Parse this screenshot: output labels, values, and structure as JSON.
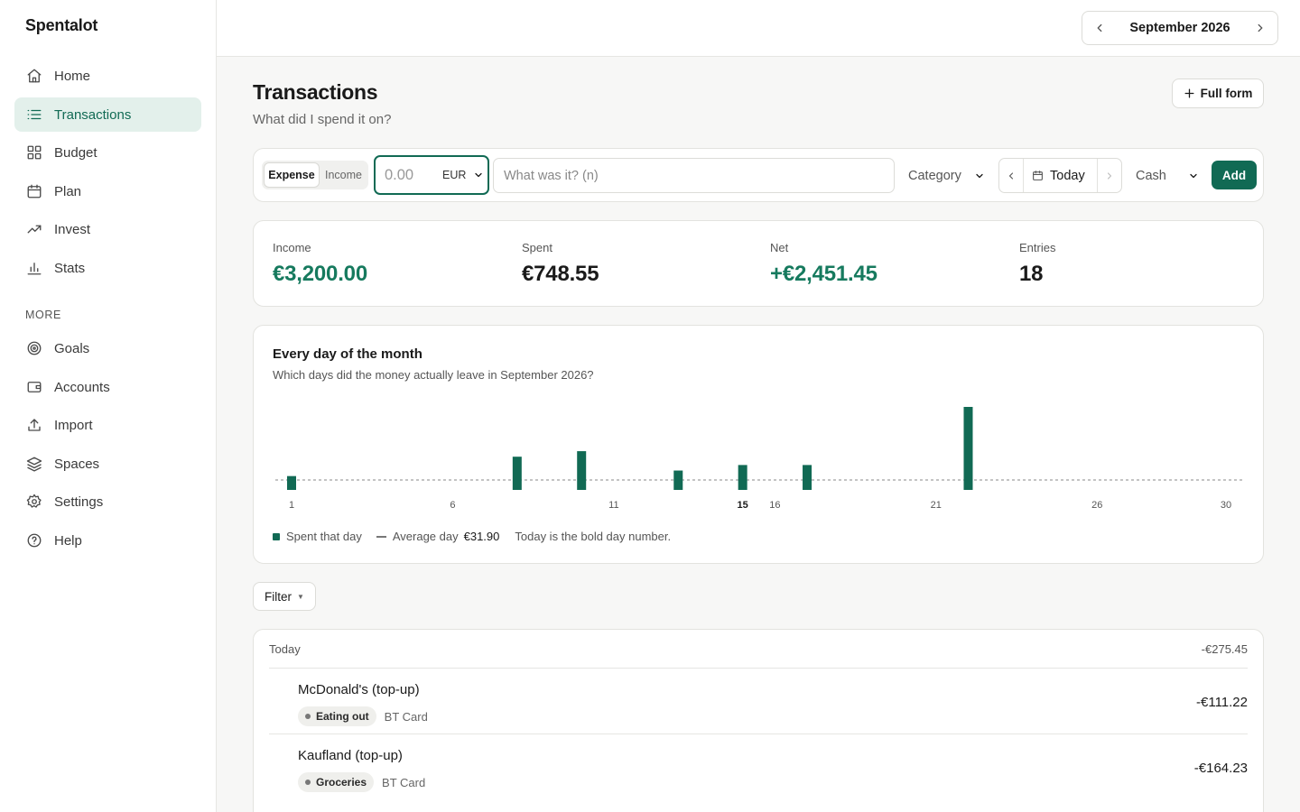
{
  "app": {
    "name": "Spentalot"
  },
  "sidebar": {
    "items": [
      {
        "label": "Home",
        "icon": "home-icon"
      },
      {
        "label": "Transactions",
        "icon": "list-icon",
        "active": true
      },
      {
        "label": "Budget",
        "icon": "grid-icon"
      },
      {
        "label": "Plan",
        "icon": "calendar-icon"
      },
      {
        "label": "Invest",
        "icon": "trending-up-icon"
      },
      {
        "label": "Stats",
        "icon": "bar-chart-icon"
      }
    ],
    "more_label": "MORE",
    "more_items": [
      {
        "label": "Goals",
        "icon": "target-icon"
      },
      {
        "label": "Accounts",
        "icon": "wallet-icon"
      },
      {
        "label": "Import",
        "icon": "upload-icon"
      },
      {
        "label": "Spaces",
        "icon": "layers-icon"
      },
      {
        "label": "Settings",
        "icon": "gear-icon"
      },
      {
        "label": "Help",
        "icon": "help-circle-icon"
      }
    ]
  },
  "topbar": {
    "month": "September 2026"
  },
  "page": {
    "title": "Transactions",
    "subtitle": "What did I spend it on?",
    "full_form_label": "Full form"
  },
  "quick_add": {
    "type_options": [
      "Expense",
      "Income"
    ],
    "selected_type": "Expense",
    "amount_placeholder": "0.00",
    "currency": "EUR",
    "description_placeholder": "What was it? (n)",
    "category": "Category",
    "date": "Today",
    "account": "Cash",
    "add_label": "Add"
  },
  "summary": {
    "income_label": "Income",
    "income": "€3,200.00",
    "spent_label": "Spent",
    "spent": "€748.55",
    "net_label": "Net",
    "net": "+€2,451.45",
    "entries_label": "Entries",
    "entries": "18"
  },
  "chart_data": {
    "type": "bar",
    "title": "Every day of the month",
    "subtitle": "Which days did the money actually leave in September 2026?",
    "x_tick_labels": [
      "1",
      "6",
      "11",
      "15",
      "16",
      "21",
      "26",
      "30"
    ],
    "highlight_day": 15,
    "days": [
      1,
      2,
      3,
      4,
      5,
      6,
      7,
      8,
      9,
      10,
      11,
      12,
      13,
      14,
      15,
      16,
      17,
      18,
      19,
      20,
      21,
      22,
      23,
      24,
      25,
      26,
      27,
      28,
      29,
      30
    ],
    "values": [
      10,
      0,
      0,
      0,
      0,
      0,
      0,
      24,
      0,
      28,
      0,
      0,
      14,
      0,
      18,
      0,
      18,
      0,
      0,
      0,
      0,
      60,
      0,
      0,
      0,
      0,
      0,
      0,
      0,
      0
    ],
    "values_note": "",
    "series": [
      {
        "name": "Spent that day"
      }
    ],
    "average_label": "Average day",
    "average_value": "€31.90",
    "note": "Today is the bold day number.",
    "colors": {
      "bar": "#116a54",
      "avg_line": "#888888"
    }
  },
  "filter": {
    "label": "Filter"
  },
  "transactions": {
    "group_label": "Today",
    "group_total": "-€275.45",
    "items": [
      {
        "name": "McDonald's (top-up)",
        "category": "Eating out",
        "account": "BT Card",
        "amount": "-€111.22"
      },
      {
        "name": "Kaufland (top-up)",
        "category": "Groceries",
        "account": "BT Card",
        "amount": "-€164.23"
      }
    ]
  },
  "colors": {
    "accent": "#116a54",
    "positive": "#167a5e",
    "active_bg": "#e3f0eb"
  }
}
